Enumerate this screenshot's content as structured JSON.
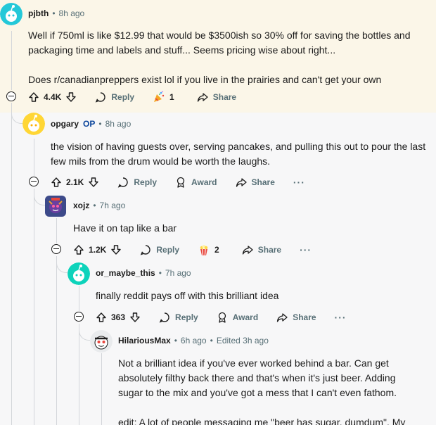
{
  "comments": [
    {
      "user": "pjbth",
      "op": "",
      "time": "8h ago",
      "edited": "",
      "body": [
        "Well if 750ml is like $12.99 that would be $3500ish so 30% off for saving the bottles and packaging time and labels and stuff... Seems pricing wise about right...",
        "Does r/canadianpreppers exist lol if you live in the prairies and can't get your own"
      ],
      "votes": "4.4K",
      "reply_label": "Reply",
      "award_label": "",
      "award_count": "1",
      "share_label": "Share",
      "more_label": ""
    },
    {
      "user": "opgary",
      "op": "OP",
      "time": "8h ago",
      "edited": "",
      "body": [
        "the vision of having guests over, serving pancakes, and pulling this out to pour the last few mils from the drum would be worth the laughs."
      ],
      "votes": "2.1K",
      "reply_label": "Reply",
      "award_label": "Award",
      "award_count": "",
      "share_label": "Share",
      "more_label": "···"
    },
    {
      "user": "xojz",
      "op": "",
      "time": "7h ago",
      "edited": "",
      "body": [
        "Have it on tap like a bar"
      ],
      "votes": "1.2K",
      "reply_label": "Reply",
      "award_label": "",
      "award_count": "2",
      "share_label": "Share",
      "more_label": "···"
    },
    {
      "user": "or_maybe_this",
      "op": "",
      "time": "7h ago",
      "edited": "",
      "body": [
        "finally reddit pays off with this brilliant idea"
      ],
      "votes": "363",
      "reply_label": "Reply",
      "award_label": "Award",
      "award_count": "",
      "share_label": "Share",
      "more_label": "···"
    },
    {
      "user": "HilariousMax",
      "op": "",
      "time": "6h ago",
      "edited": "Edited 3h ago",
      "body": [
        "Not a brilliant idea if you've ever worked behind a bar. Can get absolutely filthy back there and that's when it's just beer. Adding sugar to the mix and you've got a mess that I can't even fathom.",
        "edit: A lot of people messaging me \"beer has sugar, dumdum\". My"
      ]
    }
  ],
  "colors": {
    "highlight": "#fbf6e8",
    "text": "#1c1c1c",
    "meta": "#576f76",
    "op": "#0a449b",
    "avatar_cyan": "#24c8d8",
    "avatar_yellow": "#ffd635",
    "avatar_teal": "#0dd3bb",
    "avatar_purple": "#6a3fa0"
  },
  "icons": [
    "upvote-icon",
    "downvote-icon",
    "reply-icon",
    "award-icon",
    "share-icon",
    "collapse-icon",
    "party-popper-icon",
    "popcorn-icon"
  ]
}
